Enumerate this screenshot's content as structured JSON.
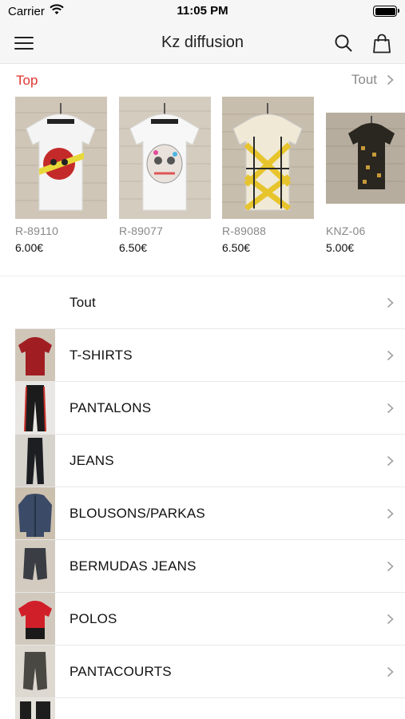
{
  "status_bar": {
    "carrier": "Carrier",
    "time": "11:05 PM"
  },
  "nav": {
    "title": "Kz diffusion",
    "left_icon": "menu-icon",
    "right_icons": [
      "search-icon",
      "shopping-bag-icon"
    ]
  },
  "top_section": {
    "title": "Top",
    "see_all": "Tout",
    "title_color": "#e0352f",
    "products": [
      {
        "sku": "R-89110",
        "price": "6.00€"
      },
      {
        "sku": "R-89077",
        "price": "6.50€"
      },
      {
        "sku": "R-89088",
        "price": "6.50€"
      },
      {
        "sku": "KNZ-06",
        "price": "5.00€"
      }
    ]
  },
  "categories": [
    {
      "label": "Tout"
    },
    {
      "label": "T-SHIRTS"
    },
    {
      "label": "PANTALONS"
    },
    {
      "label": "JEANS"
    },
    {
      "label": "BLOUSONS/PARKAS"
    },
    {
      "label": "BERMUDAS JEANS"
    },
    {
      "label": "POLOS"
    },
    {
      "label": "PANTACOURTS"
    }
  ]
}
